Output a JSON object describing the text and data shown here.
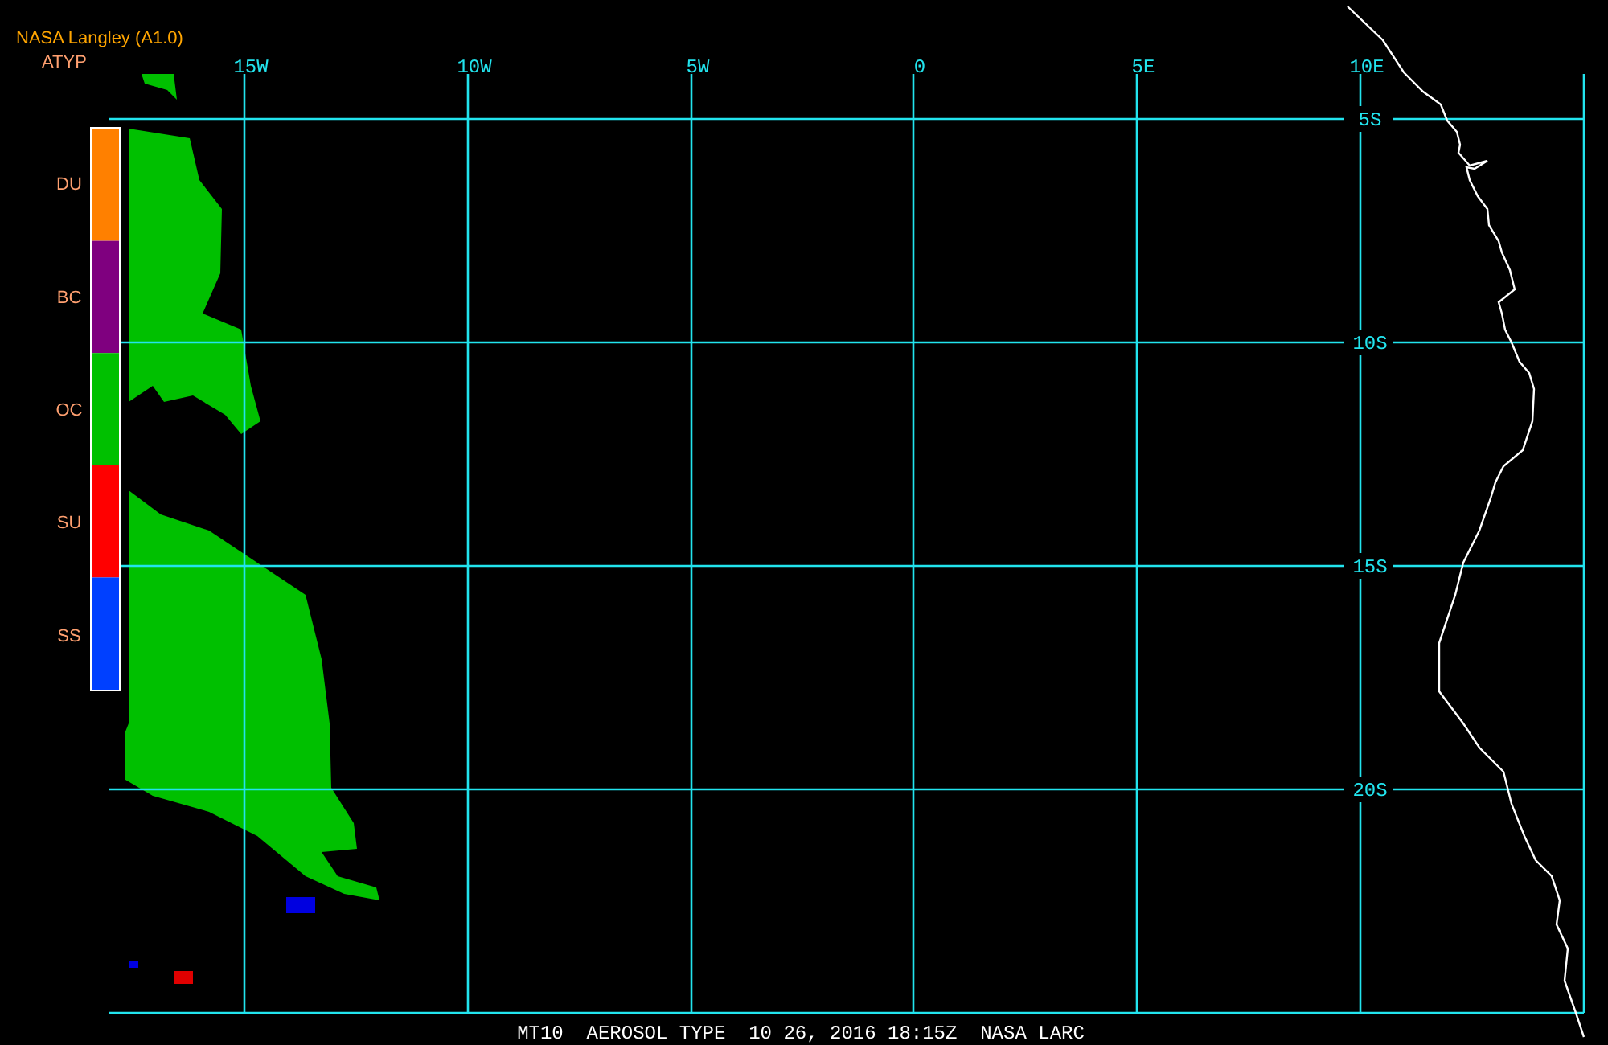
{
  "header": {
    "title": "NASA Langley (A1.0)",
    "product": "ATYP"
  },
  "legend": [
    {
      "label": "DU",
      "color": "#ff8000"
    },
    {
      "label": "BC",
      "color": "#7f007f"
    },
    {
      "label": "OC",
      "color": "#00c000"
    },
    {
      "label": "SU",
      "color": "#ff0000"
    },
    {
      "label": "SS",
      "color": "#0040ff"
    }
  ],
  "longitude_labels": [
    "15W",
    "10W",
    "5W",
    "0",
    "5E",
    "10E"
  ],
  "latitude_labels": [
    "5S",
    "10S",
    "15S",
    "20S"
  ],
  "footer": "MT10  AEROSOL TYPE  10 26, 2016 18:15Z  NASA LARC"
}
